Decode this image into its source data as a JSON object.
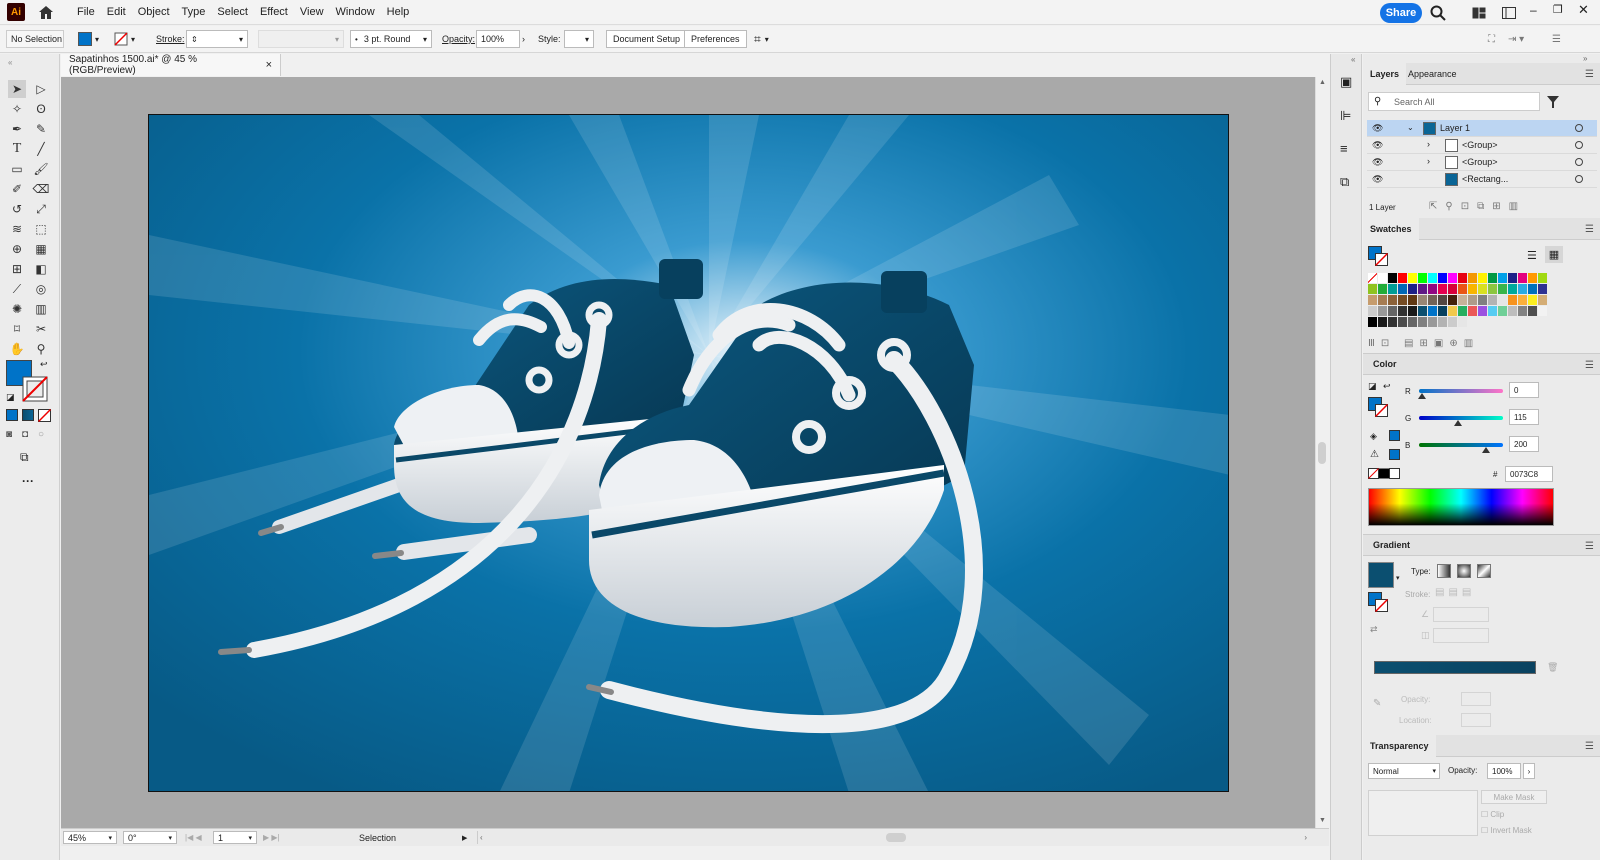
{
  "app": {
    "logo": "Ai",
    "share_label": "Share"
  },
  "menu": [
    "File",
    "Edit",
    "Object",
    "Type",
    "Select",
    "Effect",
    "View",
    "Window",
    "Help"
  ],
  "control_bar": {
    "selection": "No Selection",
    "stroke_label": "Stroke:",
    "brush": "3 pt. Round",
    "opacity_label": "Opacity:",
    "opacity": "100%",
    "style_label": "Style:",
    "document_setup": "Document Setup",
    "preferences": "Preferences"
  },
  "document": {
    "tab_title": "Sapatinhos 1500.ai* @ 45 % (RGB/Preview)",
    "close": "×"
  },
  "status": {
    "zoom": "45%",
    "rotation": "0°",
    "artboard": "1",
    "tool": "Selection"
  },
  "layers_panel": {
    "tabs": [
      "Layers",
      "Appearance"
    ],
    "search_placeholder": "Search All",
    "rows": [
      {
        "name": "Layer 1",
        "selected": true
      },
      {
        "name": "<Group>",
        "selected": false
      },
      {
        "name": "<Group>",
        "selected": false
      },
      {
        "name": "<Rectang...",
        "selected": false
      }
    ],
    "count": "1 Layer"
  },
  "swatches_panel": {
    "title": "Swatches"
  },
  "color_panel": {
    "title": "Color",
    "r_label": "R",
    "r": "0",
    "g_label": "G",
    "g": "115",
    "b_label": "B",
    "b": "200",
    "hex_prefix": "#",
    "hex": "0073C8"
  },
  "gradient_panel": {
    "title": "Gradient",
    "type_label": "Type:",
    "stroke_label": "Stroke:",
    "opacity_label": "Opacity:",
    "location_label": "Location:"
  },
  "transparency_panel": {
    "title": "Transparency",
    "blend_mode": "Normal",
    "opacity_label": "Opacity:",
    "opacity": "100%",
    "make_mask": "Make Mask",
    "clip": "Clip",
    "invert_mask": "Invert Mask"
  },
  "colors": {
    "accent": "#1473e6",
    "fill": "#0073c8",
    "artboard_bg": "#0a6596"
  }
}
